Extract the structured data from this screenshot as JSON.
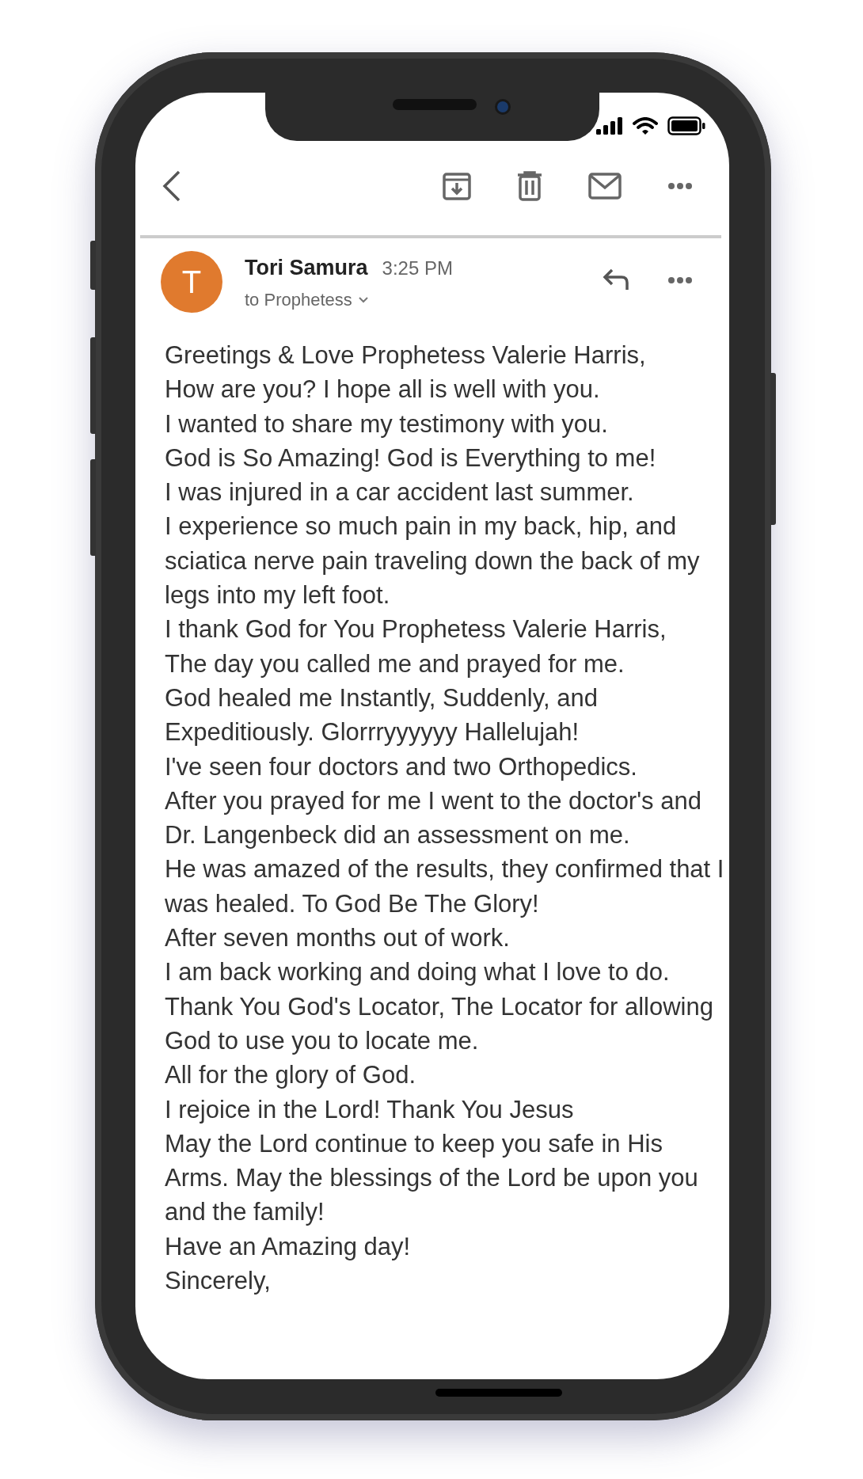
{
  "message": {
    "avatar_letter": "T",
    "sender": "Tori Samura",
    "time": "3:25 PM",
    "recipient": "to Prophetess",
    "body": [
      "Greetings & Love Prophetess Valerie Harris,",
      "How are you? I hope all is well with you.",
      "I wanted to share my testimony with you.",
      "God is So Amazing! God is Everything to me!",
      "I was injured in a car accident last summer.",
      "I experience so much pain in my back, hip, and sciatica nerve pain traveling down the back of my legs into my left foot.",
      "I thank God for You Prophetess Valerie Harris,",
      "The day you called me and prayed for me.",
      "God healed me Instantly, Suddenly, and Expeditiously. Glorrryyyyyy Hallelujah!",
      "I've seen four doctors and two Orthopedics.",
      "After you prayed for me I went to the doctor's and Dr. Langenbeck did an assessment on me.",
      "He was amazed of the results, they confirmed that I was healed. To God Be The Glory!",
      "After seven months out of work.",
      "I am back working and doing what I love to do.",
      "Thank You God's Locator, The Locator for allowing God to use you to locate me.",
      "All for the glory of God.",
      "I rejoice in the Lord! Thank You Jesus",
      "May the Lord continue to keep you safe in His Arms. May the blessings of the Lord be upon you and the family!",
      "Have an Amazing day!",
      "Sincerely,"
    ]
  }
}
